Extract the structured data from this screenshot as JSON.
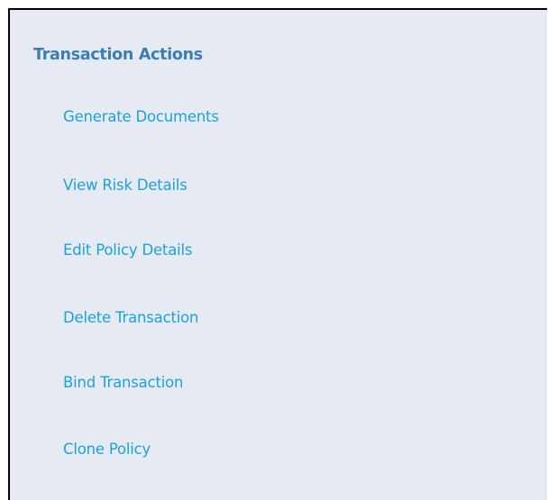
{
  "panel": {
    "title": "Transaction Actions",
    "actions": [
      {
        "label": "Generate Documents"
      },
      {
        "label": "View Risk Details"
      },
      {
        "label": "Edit Policy Details"
      },
      {
        "label": "Delete Transaction"
      },
      {
        "label": "Bind Transaction"
      },
      {
        "label": "Clone Policy"
      }
    ]
  },
  "colors": {
    "panel_background": "#e6ebf3",
    "title": "#3a7fb4",
    "link": "#1ca1de",
    "border": "#000000"
  }
}
